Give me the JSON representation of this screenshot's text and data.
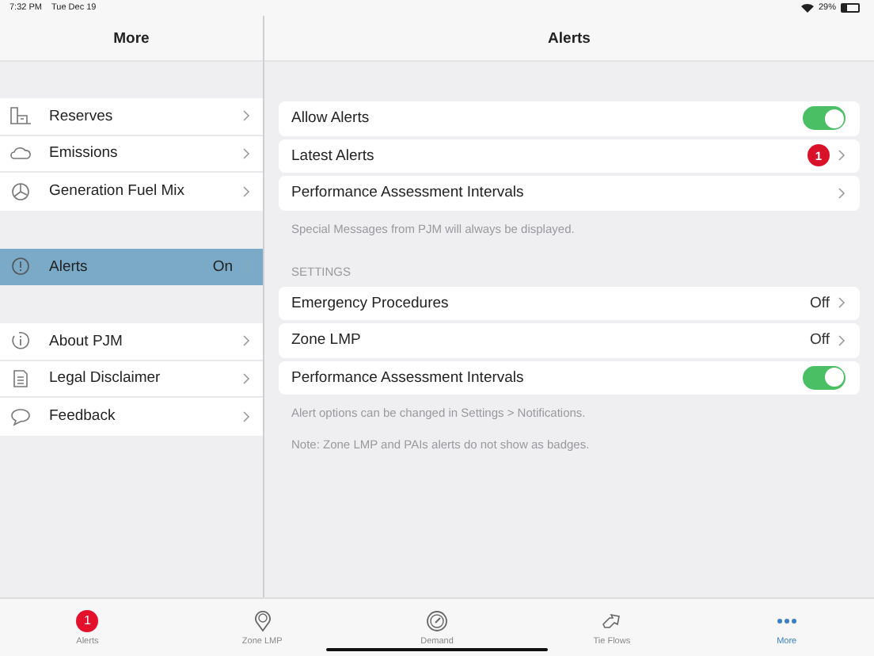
{
  "status_bar": {
    "time": "7:32 PM",
    "date": "Tue Dec 19",
    "battery": "29%"
  },
  "sidebar": {
    "title": "More",
    "groups": [
      [
        {
          "label": "Reserves",
          "selected": false
        },
        {
          "label": "Emissions",
          "selected": false
        },
        {
          "label": "Generation Fuel Mix",
          "selected": false
        }
      ],
      [
        {
          "label": "Alerts",
          "value": "On",
          "selected": true
        }
      ],
      [
        {
          "label": "About PJM",
          "selected": false
        },
        {
          "label": "Legal Disclaimer",
          "selected": false
        },
        {
          "label": "Feedback",
          "selected": false
        }
      ]
    ]
  },
  "main": {
    "title": "Alerts",
    "sections": [
      {
        "rows": [
          {
            "kind": "toggle",
            "label": "Allow Alerts",
            "on": true
          },
          {
            "kind": "disclosure",
            "label": "Latest Alerts",
            "badge": "1"
          },
          {
            "kind": "disclosure",
            "label": "Performance Assessment Intervals"
          }
        ],
        "footer": [
          "Special Messages from PJM will always be displayed."
        ]
      },
      {
        "header": "SETTINGS",
        "rows": [
          {
            "kind": "disclosure",
            "label": "Emergency Procedures",
            "value": "Off"
          },
          {
            "kind": "disclosure",
            "label": "Zone LMP",
            "value": "Off"
          },
          {
            "kind": "toggle",
            "label": "Performance Assessment Intervals",
            "on": true
          }
        ],
        "footer": [
          "Alert options can be changed in Settings > Notifications.",
          "Note: Zone LMP and PAIs alerts do not show as badges."
        ]
      }
    ]
  },
  "tab_bar": [
    {
      "label": "Alerts",
      "selected": false,
      "badge": "1"
    },
    {
      "label": "Zone LMP",
      "selected": false
    },
    {
      "label": "Demand",
      "selected": false
    },
    {
      "label": "Tie Flows",
      "selected": false
    },
    {
      "label": "More",
      "selected": true
    }
  ]
}
